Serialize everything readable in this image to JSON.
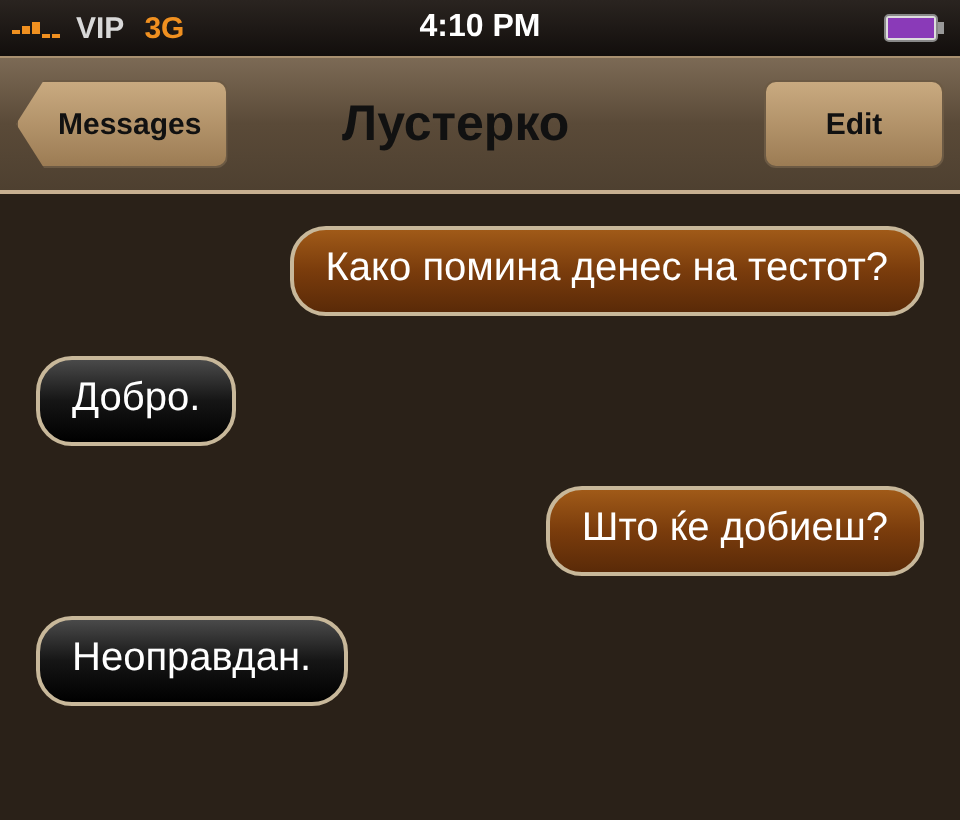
{
  "status_bar": {
    "carrier": "VIP",
    "network": "3G",
    "time": "4:10 PM"
  },
  "nav_bar": {
    "back": "Messages",
    "title": "Лустерко",
    "action": "Edit"
  },
  "messages": [
    {
      "kind": "sent",
      "text": "Како помина денес на тестот?"
    },
    {
      "kind": "received",
      "text": "Добро."
    },
    {
      "kind": "sent",
      "text": "Што ќе добиеш?"
    },
    {
      "kind": "received",
      "text": "Неоправдан."
    }
  ]
}
